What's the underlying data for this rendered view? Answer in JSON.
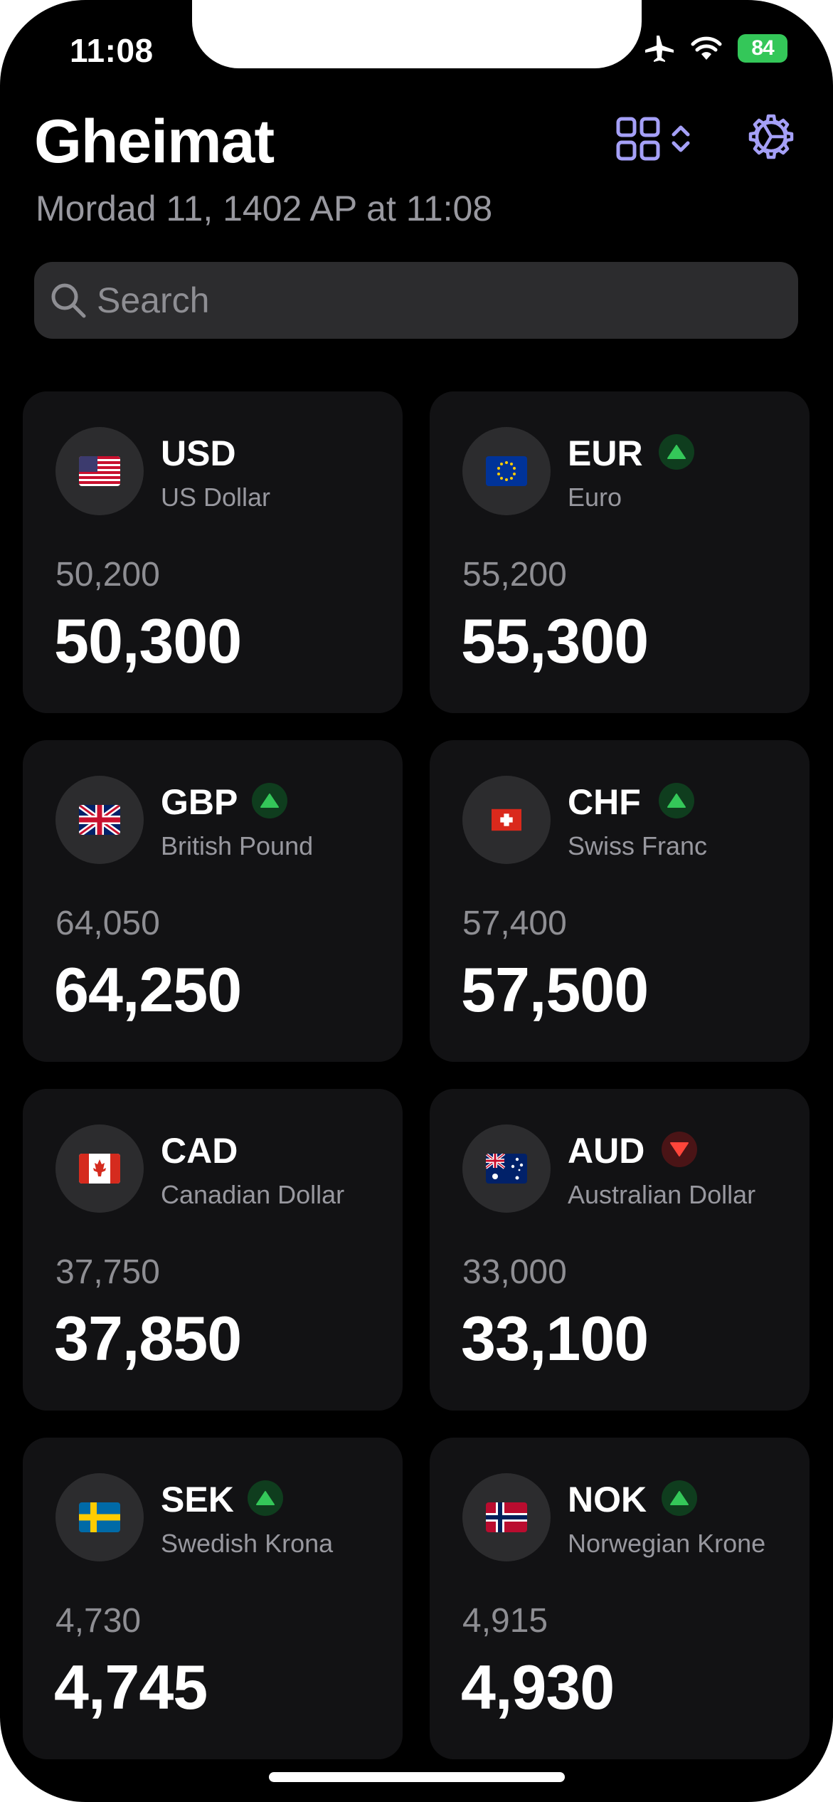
{
  "status_bar": {
    "time": "11:08",
    "battery": "84"
  },
  "header": {
    "title": "Gheimat",
    "date": "Mordad 11, 1402 AP at 11:08",
    "accent": "#a5a0f7"
  },
  "search": {
    "placeholder": "Search"
  },
  "colors": {
    "up": "#34c759",
    "down": "#ff453a",
    "card": "#121214"
  },
  "currencies": [
    {
      "code": "USD",
      "name": "US Dollar",
      "buy": "50,200",
      "sell": "50,300",
      "trend": "none",
      "flag": "us-flag"
    },
    {
      "code": "EUR",
      "name": "Euro",
      "buy": "55,200",
      "sell": "55,300",
      "trend": "up",
      "flag": "eu-flag"
    },
    {
      "code": "GBP",
      "name": "British Pound",
      "buy": "64,050",
      "sell": "64,250",
      "trend": "up",
      "flag": "uk-flag"
    },
    {
      "code": "CHF",
      "name": "Swiss Franc",
      "buy": "57,400",
      "sell": "57,500",
      "trend": "up",
      "flag": "ch-flag"
    },
    {
      "code": "CAD",
      "name": "Canadian Dollar",
      "buy": "37,750",
      "sell": "37,850",
      "trend": "none",
      "flag": "ca-flag"
    },
    {
      "code": "AUD",
      "name": "Australian Dollar",
      "buy": "33,000",
      "sell": "33,100",
      "trend": "down",
      "flag": "au-flag"
    },
    {
      "code": "SEK",
      "name": "Swedish Krona",
      "buy": "4,730",
      "sell": "4,745",
      "trend": "up",
      "flag": "se-flag"
    },
    {
      "code": "NOK",
      "name": "Norwegian Krone",
      "buy": "4,915",
      "sell": "4,930",
      "trend": "up",
      "flag": "no-flag"
    }
  ]
}
